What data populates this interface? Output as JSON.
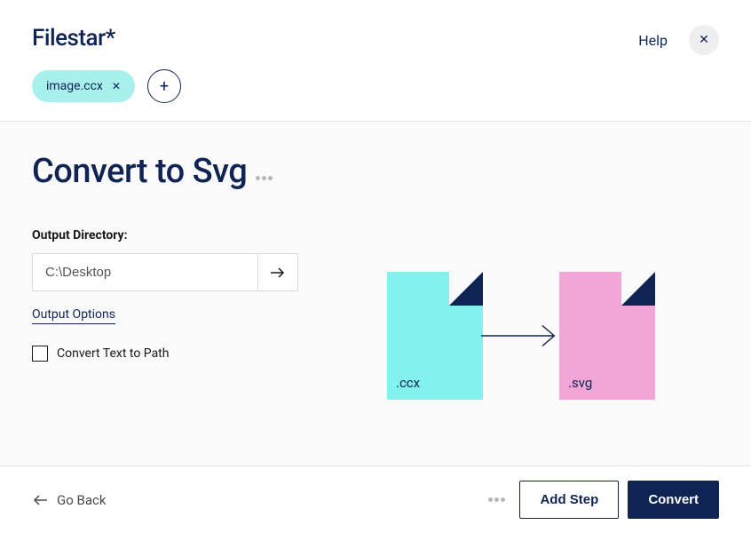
{
  "header": {
    "logo": "Filestar*",
    "help": "Help",
    "file_chip": "image.ccx"
  },
  "main": {
    "title": "Convert to Svg",
    "output_dir_label": "Output Directory:",
    "output_dir_value": "C:\\Desktop",
    "output_options": "Output Options",
    "checkbox_label": "Convert Text to Path",
    "src_ext": ".ccx",
    "dst_ext": ".svg"
  },
  "footer": {
    "go_back": "Go Back",
    "add_step": "Add Step",
    "convert": "Convert"
  }
}
